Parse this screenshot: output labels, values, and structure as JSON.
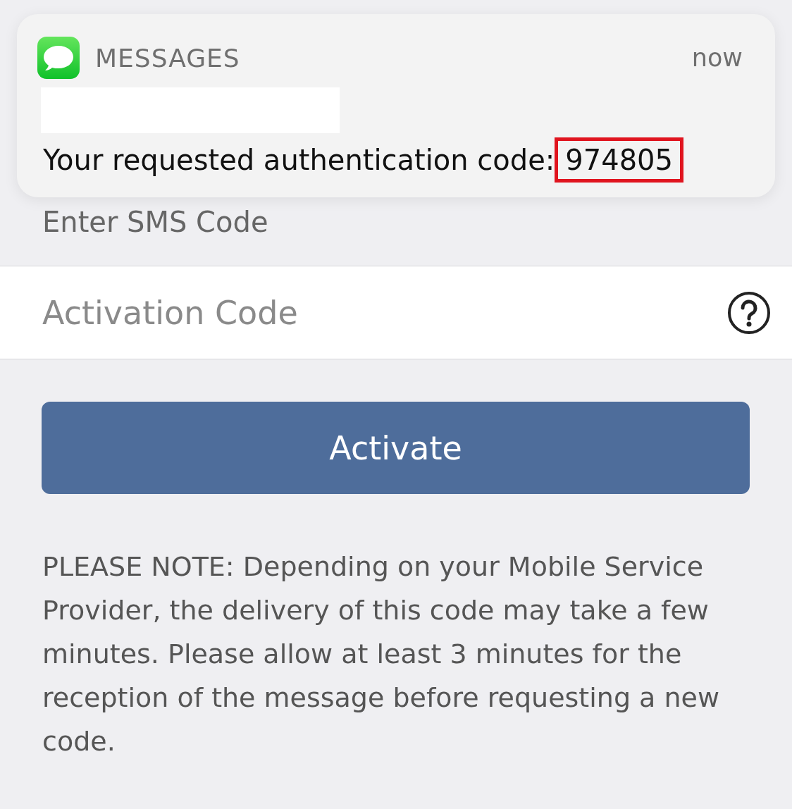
{
  "notification": {
    "app": "MESSAGES",
    "time": "now",
    "message": "Your requested authentication code:",
    "code": "974805",
    "code_highlighted": true
  },
  "sms_label": "Enter SMS Code",
  "activation_field": {
    "placeholder": "Activation Code"
  },
  "activate_button": "Activate",
  "note": "PLEASE NOTE: Depending on your Mobile Service Provider, the delivery of this code may take a few minutes. Please allow at least 3 minutes for the reception of the message before requesting a new code."
}
